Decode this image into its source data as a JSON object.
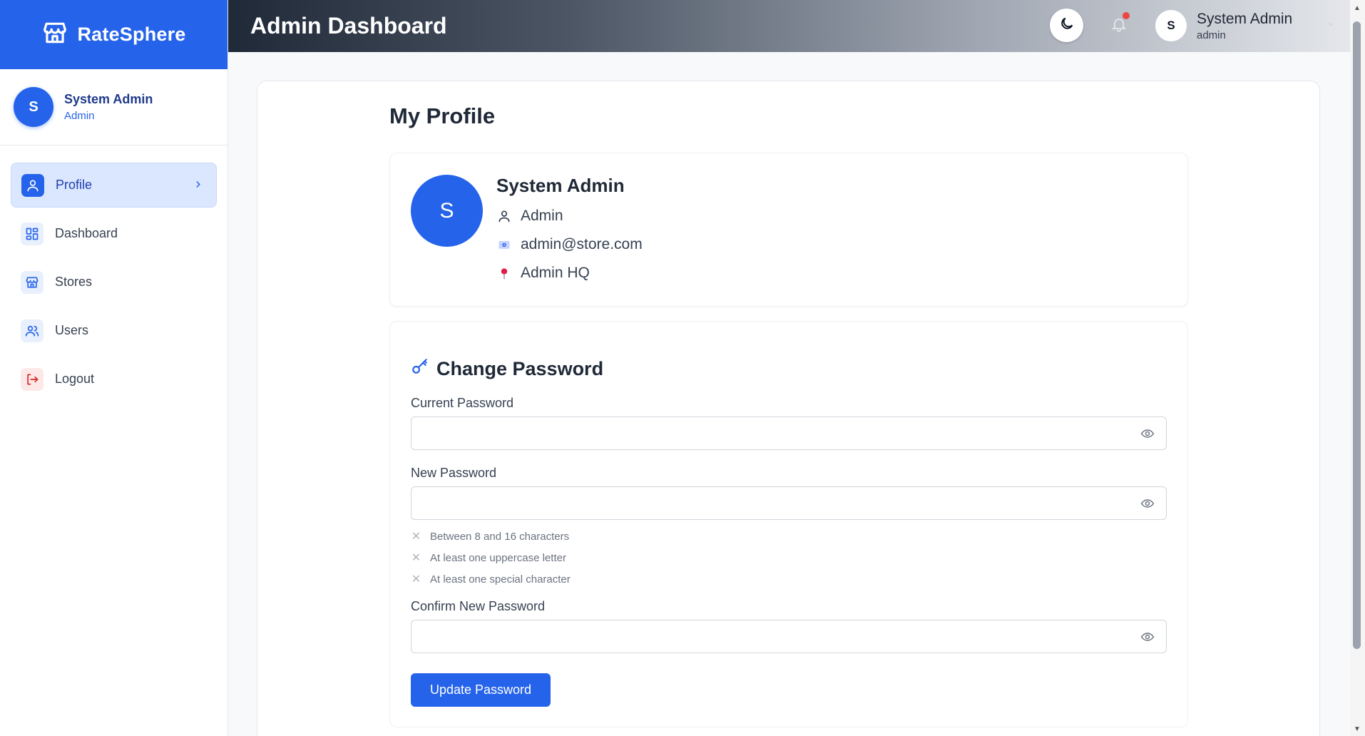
{
  "brand": {
    "name": "RateSphere",
    "icon": "store-icon"
  },
  "sidebar": {
    "user": {
      "initial": "S",
      "name": "System Admin",
      "role": "Admin"
    },
    "items": [
      {
        "label": "Profile",
        "icon": "user-icon",
        "active": true
      },
      {
        "label": "Dashboard",
        "icon": "grid-icon",
        "active": false
      },
      {
        "label": "Stores",
        "icon": "store-icon",
        "active": false
      },
      {
        "label": "Users",
        "icon": "users-icon",
        "active": false
      },
      {
        "label": "Logout",
        "icon": "logout-icon",
        "active": false
      }
    ]
  },
  "header": {
    "title": "Admin Dashboard",
    "user": {
      "initial": "S",
      "name": "System Admin",
      "role": "admin"
    }
  },
  "page": {
    "title": "My Profile"
  },
  "profile": {
    "initial": "S",
    "name": "System Admin",
    "role": "Admin",
    "email": "admin@store.com",
    "address": "Admin HQ"
  },
  "password": {
    "title": "Change Password",
    "current_label": "Current Password",
    "new_label": "New Password",
    "confirm_label": "Confirm New Password",
    "requirements": [
      "Between 8 and 16 characters",
      "At least one uppercase letter",
      "At least one special character"
    ],
    "submit_label": "Update Password"
  },
  "colors": {
    "accent": "#2563eb",
    "danger": "#dc2626",
    "notification": "#ef4444"
  }
}
